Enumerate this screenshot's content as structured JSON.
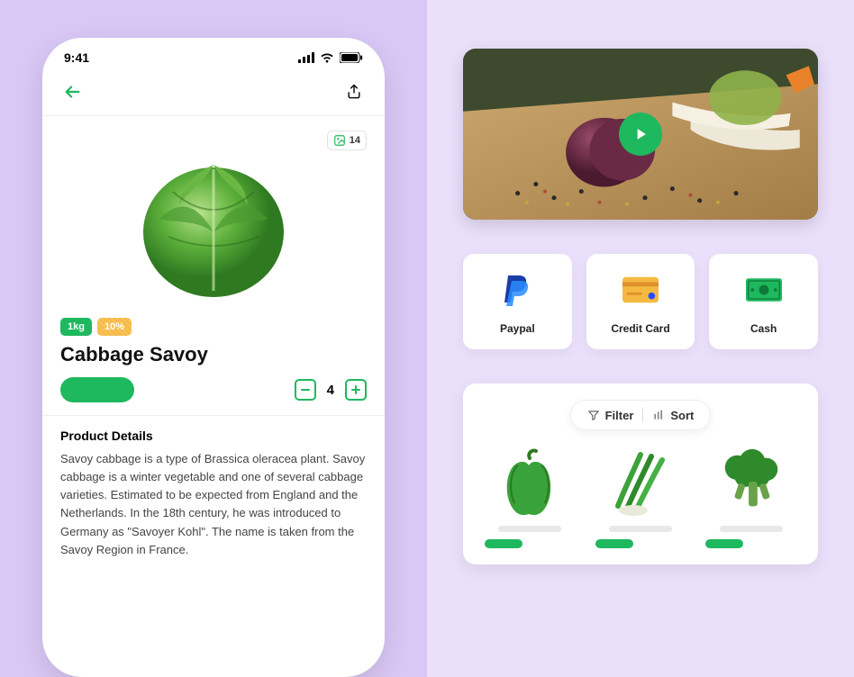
{
  "status_bar": {
    "time": "9:41"
  },
  "product": {
    "image_count": "14",
    "badge_weight": "1kg",
    "badge_discount": "10%",
    "name": "Cabbage Savoy",
    "quantity": "4",
    "details_heading": "Product Details",
    "details_body": "Savoy cabbage is a type of Brassica oleracea plant. Savoy cabbage is a winter vegetable and one of several cabbage varieties. Estimated to be expected from England and the Netherlands. In the 18th century, he was introduced to Germany as \"Savoyer Kohl\". The name is taken from the Savoy Region in France."
  },
  "payments": [
    {
      "label": "Paypal"
    },
    {
      "label": "Credit Card"
    },
    {
      "label": "Cash"
    }
  ],
  "toolbar": {
    "filter_label": "Filter",
    "sort_label": "Sort"
  },
  "colors": {
    "accent": "#1eb85e",
    "panelR": "#ebe0fb",
    "bg": "#d9c8f5"
  }
}
